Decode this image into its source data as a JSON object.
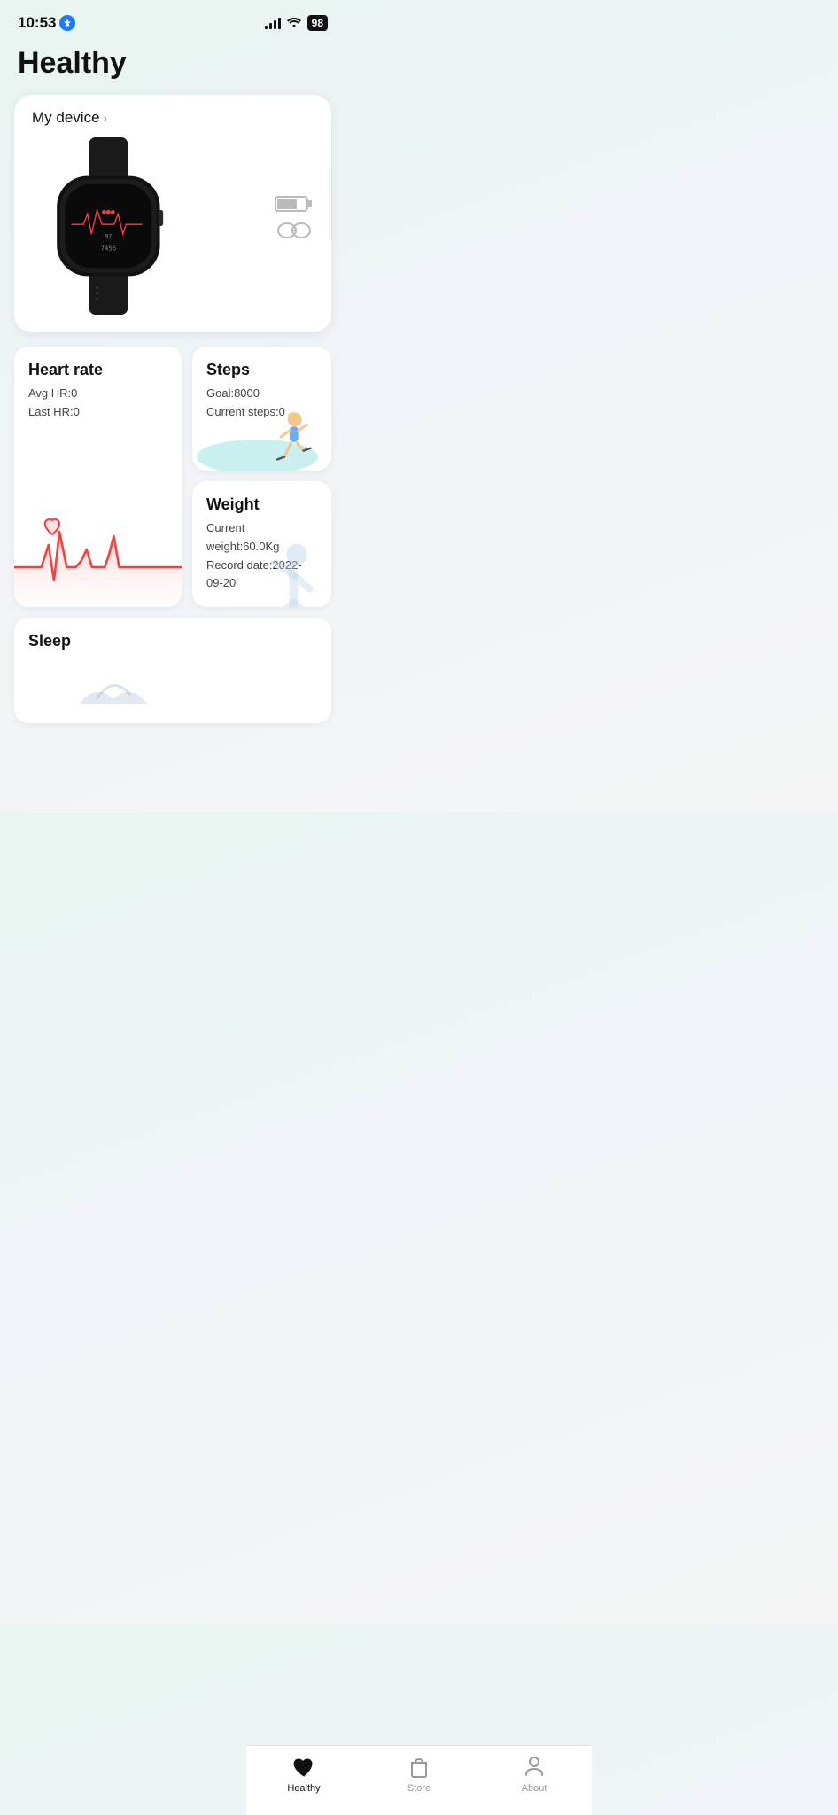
{
  "statusBar": {
    "time": "10:53",
    "battery": "98"
  },
  "pageTitle": "Healthy",
  "deviceCard": {
    "linkLabel": "My device",
    "chevron": "›"
  },
  "heartRate": {
    "title": "Heart rate",
    "avgHR": "Avg HR:0",
    "lastHR": "Last HR:0"
  },
  "steps": {
    "title": "Steps",
    "goal": "Goal:8000",
    "current": "Current steps:0"
  },
  "weight": {
    "title": "Weight",
    "currentWeight": "Current weight:60.0Kg",
    "recordDate": "Record date:2022-09-20"
  },
  "sleep": {
    "title": "Sleep"
  },
  "tabBar": {
    "healthy": "Healthy",
    "store": "Store",
    "about": "About"
  }
}
